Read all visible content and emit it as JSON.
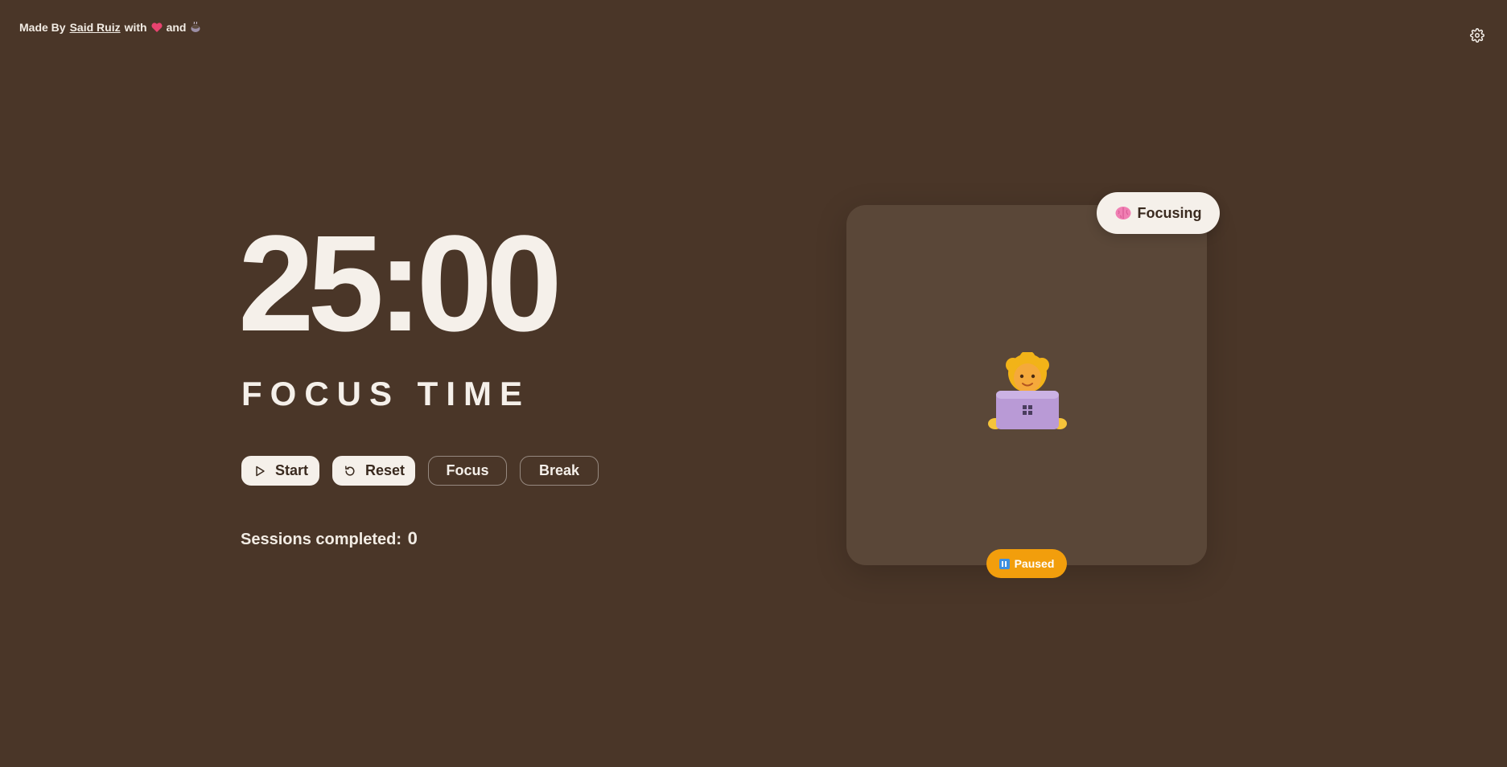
{
  "credit": {
    "prefix": "Made By",
    "author": "Said Ruiz",
    "with": "with",
    "and": "and",
    "icons": [
      "heart-icon",
      "coffee-icon"
    ]
  },
  "settings": {
    "icon": "gear-icon"
  },
  "timer": {
    "display": "25:00",
    "mode_label": "FOCUS TIME"
  },
  "controls": {
    "start_label": "Start",
    "reset_label": "Reset",
    "focus_label": "Focus",
    "break_label": "Break"
  },
  "sessions": {
    "label": "Sessions completed:",
    "count": "0"
  },
  "card": {
    "badge_label": "Focusing",
    "badge_icon": "brain-icon",
    "illustration": "person-at-laptop-icon",
    "status_label": "Paused",
    "status_icon": "pause-icon"
  },
  "colors": {
    "background": "#4a3628",
    "card": "#5a4738",
    "text": "#f5f0ea",
    "status": "#f29e0c"
  }
}
